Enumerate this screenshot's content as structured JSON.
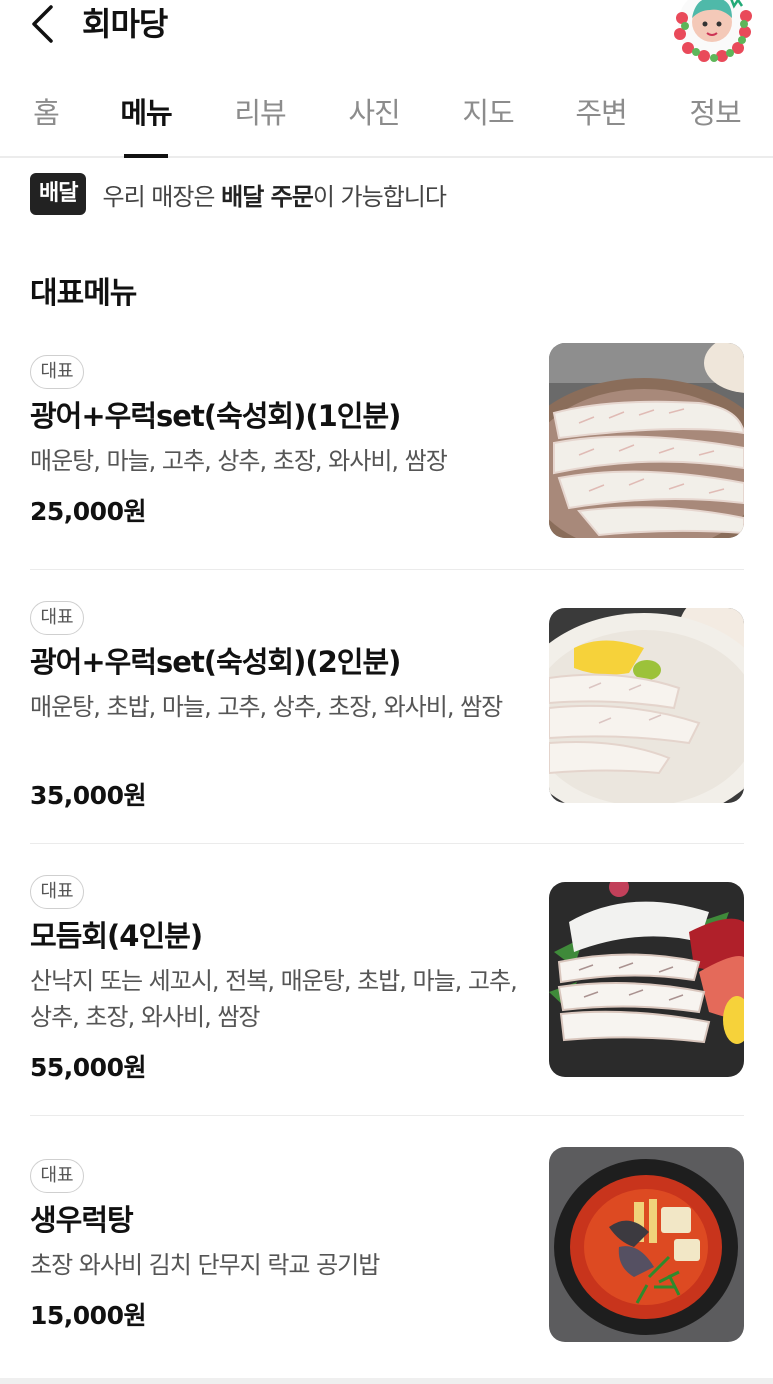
{
  "header": {
    "title": "회마당",
    "back_icon": "chevron-left-icon",
    "profile_icon": "avatar-wreath-icon"
  },
  "tabs": [
    {
      "label": "홈"
    },
    {
      "label": "메뉴",
      "active": true
    },
    {
      "label": "리뷰"
    },
    {
      "label": "사진"
    },
    {
      "label": "지도"
    },
    {
      "label": "주변"
    },
    {
      "label": "정보"
    }
  ],
  "notice": {
    "badge": "배달",
    "text_before": "우리 매장은 ",
    "text_bold": "배달 주문",
    "text_after": "이 가능합니다"
  },
  "section_title": "대표메뉴",
  "menu_items": [
    {
      "badge": "대표",
      "name": "광어+우럭set(숙성회)(1인분)",
      "desc": "매운탕, 마늘, 고추, 상추, 초장, 와사비, 쌈장",
      "price": "25,000원"
    },
    {
      "badge": "대표",
      "name": "광어+우럭set(숙성회)(2인분)",
      "desc": "매운탕, 초밥, 마늘, 고추, 상추, 초장, 와사비, 쌈장",
      "price": "35,000원"
    },
    {
      "badge": "대표",
      "name": "모듬회(4인분)",
      "desc": "산낙지 또는 세꼬시, 전복, 매운탕, 초밥, 마늘, 고추, 상추, 초장, 와사비, 쌈장",
      "price": "55,000원"
    },
    {
      "badge": "대표",
      "name": "생우럭탕",
      "desc": "초장 와사비 김치 단무지 락교 공기밥",
      "price": "15,000원"
    }
  ],
  "colors": {
    "accent": "#111111",
    "tab_inactive": "#8c8c8c",
    "badge_bg": "#222222",
    "divider": "#ebebeb"
  }
}
